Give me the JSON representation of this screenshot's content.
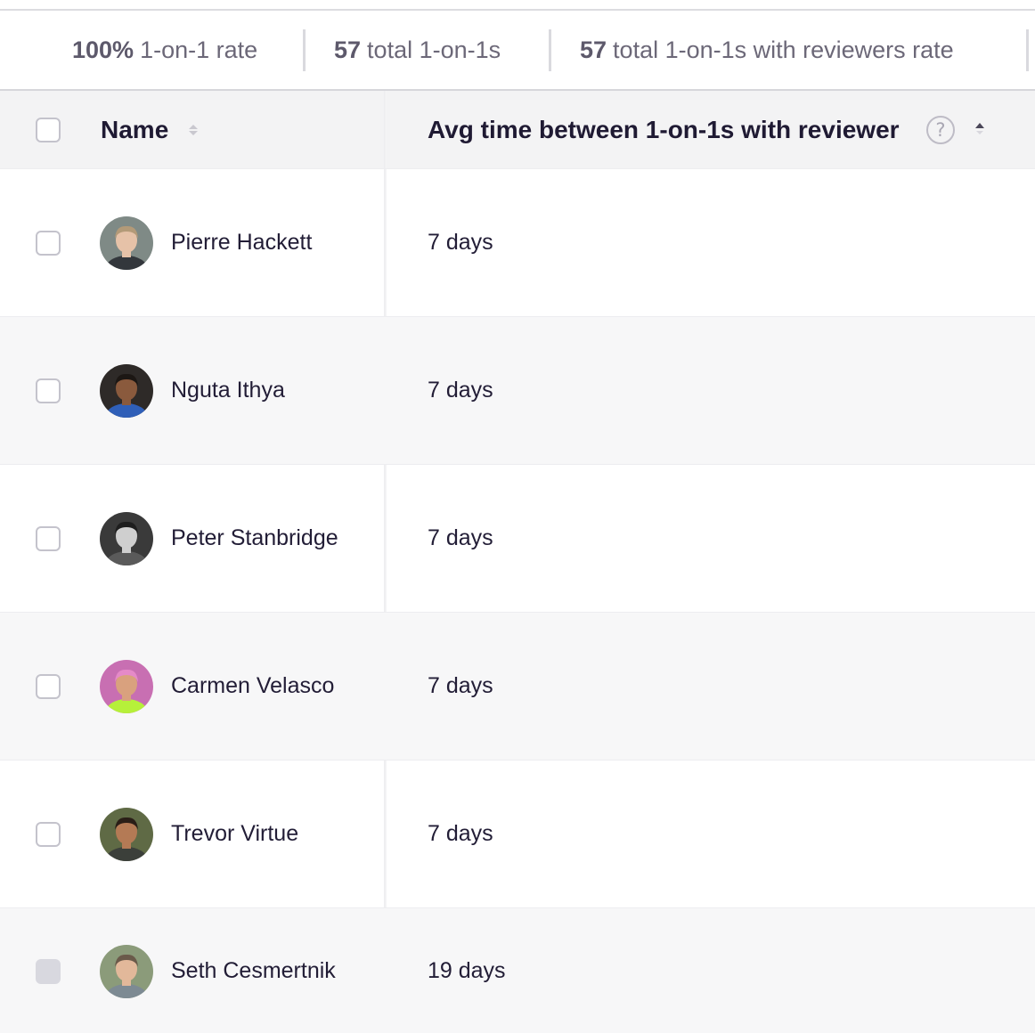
{
  "stats": [
    {
      "value": "100%",
      "label": "1-on-1 rate"
    },
    {
      "value": "57",
      "label": "total 1-on-1s"
    },
    {
      "value": "57",
      "label": "total 1-on-1s with reviewers rate"
    }
  ],
  "table": {
    "columns": {
      "name": "Name",
      "avg": "Avg time between 1-on-1s with reviewer"
    },
    "help_icon": "?",
    "rows": [
      {
        "name": "Pierre Hackett",
        "avg": "7 days",
        "checkbox_disabled": false
      },
      {
        "name": "Nguta Ithya",
        "avg": "7 days",
        "checkbox_disabled": false
      },
      {
        "name": "Peter Stanbridge",
        "avg": "7 days",
        "checkbox_disabled": false
      },
      {
        "name": "Carmen Velasco",
        "avg": "7 days",
        "checkbox_disabled": false
      },
      {
        "name": "Trevor Virtue",
        "avg": "7 days",
        "checkbox_disabled": false
      },
      {
        "name": "Seth Cesmertnik",
        "avg": "19 days",
        "checkbox_disabled": true
      }
    ]
  },
  "colors": {
    "text_primary": "#1f1a33",
    "text_muted": "#6c6878",
    "header_bg": "#f3f3f4",
    "row_alt_bg": "#f7f7f8"
  }
}
